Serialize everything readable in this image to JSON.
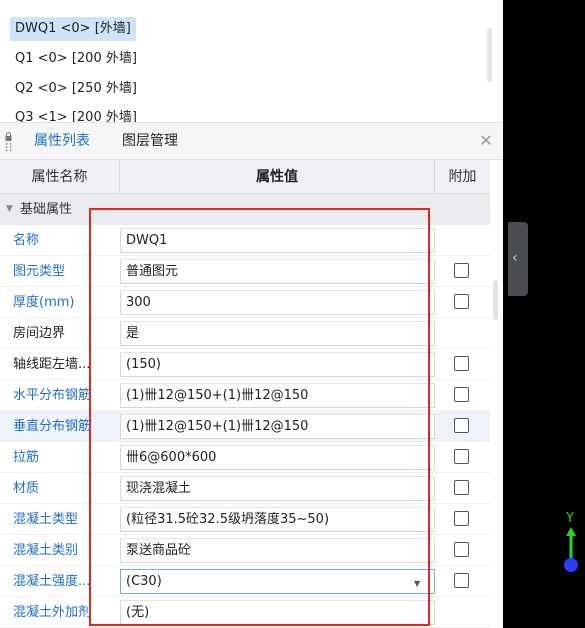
{
  "wall_list": {
    "items": [
      {
        "label": "DWQ1 <0> [外墙]",
        "selected": true
      },
      {
        "label": "Q1 <0> [200 外墙]",
        "selected": false
      },
      {
        "label": "Q2 <0> [250 外墙]",
        "selected": false
      },
      {
        "label": "Q3 <1> [200 外墙]",
        "selected": false
      }
    ]
  },
  "tabs": {
    "properties": "属性列表",
    "layers": "图层管理"
  },
  "table": {
    "header": {
      "name": "属性名称",
      "value": "属性值",
      "extra": "附加"
    },
    "section": "基础属性",
    "rows": [
      {
        "name": "名称",
        "value": "DWQ1",
        "name_color": "blue",
        "checkbox": false
      },
      {
        "name": "图元类型",
        "value": "普通图元",
        "name_color": "blue",
        "checkbox": true
      },
      {
        "name": "厚度(mm)",
        "value": "300",
        "name_color": "blue",
        "checkbox": true
      },
      {
        "name": "房间边界",
        "value": "是",
        "name_color": "black",
        "checkbox": false
      },
      {
        "name": "轴线距左墙...",
        "value": "(150)",
        "name_color": "black",
        "checkbox": true
      },
      {
        "name": "水平分布钢筋",
        "value": "(1)卌12@150+(1)卌12@150",
        "name_color": "blue",
        "checkbox": true
      },
      {
        "name": "垂直分布钢筋",
        "value": "(1)卌12@150+(1)卌12@150",
        "name_color": "blue",
        "checkbox": true,
        "highlight": true
      },
      {
        "name": "拉筋",
        "value": "卌6@600*600",
        "name_color": "blue",
        "checkbox": true
      },
      {
        "name": "材质",
        "value": "现浇混凝土",
        "name_color": "blue",
        "checkbox": true
      },
      {
        "name": "混凝土类型",
        "value": "(粒径31.5砼32.5级坍落度35~50)",
        "name_color": "blue",
        "checkbox": true
      },
      {
        "name": "混凝土类别",
        "value": "泵送商品砼",
        "name_color": "blue",
        "checkbox": true
      },
      {
        "name": "混凝土强度...",
        "value": "(C30)",
        "name_color": "blue",
        "checkbox": true,
        "dropdown": true
      },
      {
        "name": "混凝土外加剂",
        "value": "(无)",
        "name_color": "blue",
        "checkbox": false
      }
    ]
  },
  "axis": {
    "y_label": "Y"
  },
  "colors": {
    "accent_blue": "#1f6fc4",
    "selection_bg": "#cfe3f8",
    "highlight_border": "#e1261c",
    "axis_green": "#26d62b",
    "axis_blue": "#2b3bff"
  },
  "icons": [
    "lock-icon",
    "close-icon",
    "collapse-chevron-icon",
    "section-caret-icon",
    "dropdown-caret-icon"
  ]
}
